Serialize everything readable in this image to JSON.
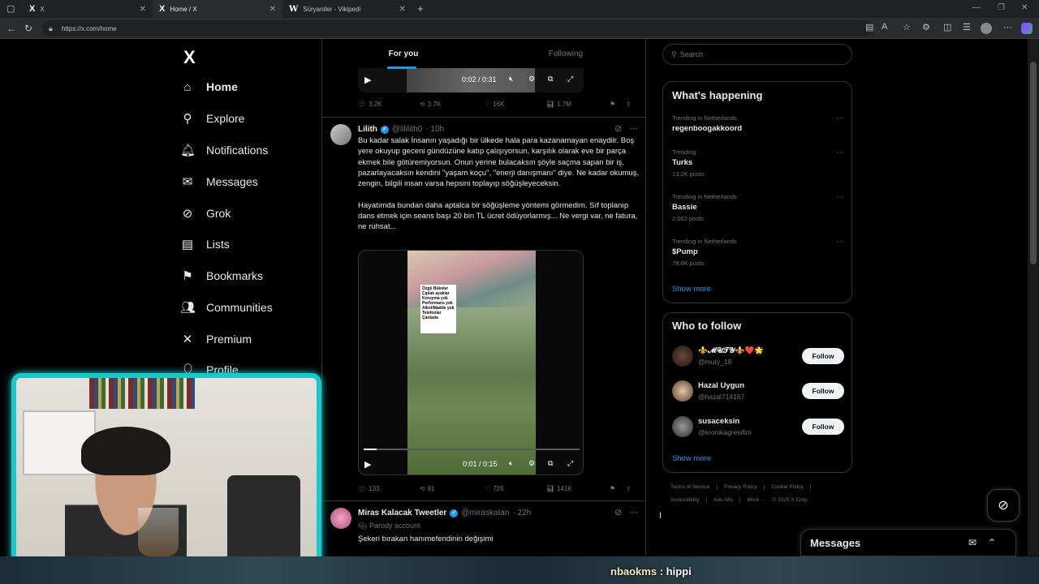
{
  "browser": {
    "tabs": [
      {
        "icon": "X",
        "title": "X"
      },
      {
        "icon": "X",
        "title": "Home / X"
      },
      {
        "icon": "W",
        "title": "Süryaniler - Vikipedi"
      }
    ],
    "url": "https://x.com/home"
  },
  "nav": {
    "logo": "X",
    "items": [
      {
        "label": "Home",
        "icon": "home-icon"
      },
      {
        "label": "Explore",
        "icon": "search-icon"
      },
      {
        "label": "Notifications",
        "icon": "bell-icon"
      },
      {
        "label": "Messages",
        "icon": "envelope-icon"
      },
      {
        "label": "Grok",
        "icon": "grok-icon"
      },
      {
        "label": "Lists",
        "icon": "list-icon"
      },
      {
        "label": "Bookmarks",
        "icon": "bookmark-icon"
      },
      {
        "label": "Communities",
        "icon": "people-icon"
      },
      {
        "label": "Premium",
        "icon": "x-icon"
      },
      {
        "label": "Profile",
        "icon": "person-icon"
      }
    ]
  },
  "feed": {
    "tabs": [
      "For you",
      "Following"
    ],
    "video1": {
      "time": "0:02 / 0:31",
      "progress": 0.06
    },
    "post1_stats": {
      "replies": "3.2K",
      "reposts": "3.7K",
      "likes": "16K",
      "views": "1.7M"
    },
    "post2": {
      "name": "Lilith",
      "handle": "@lililith0",
      "age": "· 10h",
      "text": "Bu kadar salak İnsanın yaşadığı bir ülkede hala para kazanamayan enaydilr. Boş yere okuyup geceni gündüzüne katıp çalışıyorsun, karşılık olarak eve bir parça ekmek bile götüremiyorsun. Onun yerine bulacaksın şöyle saçma sapan bir iş, pazarlayacaksın kendini \"yaşam koçu\", \"enerji danışmanı\" diye. Ne kadar okumuş, zengin, bilgili insan varsa hepsini toplayıp söğüşleyeceksin.\n\nHayatımda bundan daha aptalca bir söğüşleme yöntemi görmedim. Sıf toplanıp dans etmek için seans başı 20 bin TL ücret ödüyorlarmış... Ne vergi var, ne fatura, ne ruhsat...",
      "video_sign": "Özgü Bükeler\nÇıplak ayaklar\nKoruyma yok\nPerformans yok\nAlkol/Madde yok\nTelefonlar Çantada",
      "video_time": "0:01 / 0:15",
      "stats": {
        "replies": "133",
        "reposts": "81",
        "likes": "726",
        "views": "141K"
      }
    },
    "post3": {
      "name": "Miras Kalacak Tweetler",
      "handle": "@miraskaIan",
      "age": "· 22h",
      "label": "Parody account",
      "text": "Şekeri bırakan hanımefendinin değişimi"
    }
  },
  "right": {
    "search_placeholder": "Search",
    "happening_title": "What's happening",
    "trends": [
      {
        "context": "Trending in Netherlands",
        "name": "regenboogakkoord",
        "posts": ""
      },
      {
        "context": "Trending",
        "name": "Turks",
        "posts": "13.2K posts"
      },
      {
        "context": "Trending in Netherlands",
        "name": "Bassie",
        "posts": "2,062 posts"
      },
      {
        "context": "Trending in Netherlands",
        "name": "$Pump",
        "posts": "78.6K posts"
      }
    ],
    "show_more": "Show more",
    "wtf_title": "Who to follow",
    "follow_suggestions": [
      {
        "name": "⚜️𝓜𝓤𝓣𝓨⚜️❤️🌟",
        "handle": "@muty_18"
      },
      {
        "name": "Hazal Uygun",
        "handle": "@hazal714167"
      },
      {
        "name": "susaceksin",
        "handle": "@kronikagresifim"
      }
    ],
    "follow_label": "Follow",
    "footer_row1": [
      "Terms of Service",
      "Privacy Policy",
      "Cookie Policy"
    ],
    "footer_row2": [
      "Accessibility",
      "Ads info",
      "More ···",
      "© 2025 X Corp."
    ]
  },
  "messages_drawer": {
    "title": "Messages"
  },
  "chat_overlay": {
    "user": "nbaokms",
    "message": "hippi"
  }
}
